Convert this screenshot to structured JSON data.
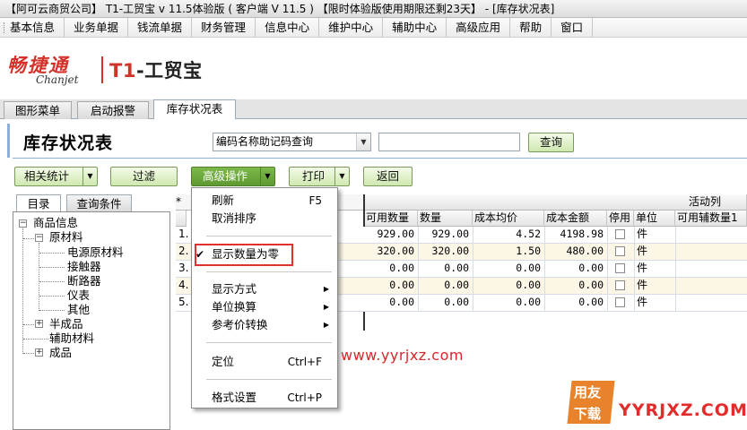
{
  "window": {
    "title": "【阿可云商贸公司】 T1-工贸宝 v 11.5体验版 ( 客户端 V 11.5 ) 【限时体验版使用期限还剩23天】 - [库存状况表]"
  },
  "menubar": [
    "基本信息",
    "业务单据",
    "钱流单据",
    "财务管理",
    "信息中心",
    "维护中心",
    "辅助中心",
    "高级应用",
    "帮助",
    "窗口"
  ],
  "brand": {
    "cn": "畅捷通",
    "en": "Chanjet",
    "product_prefix": "T1",
    "product_suffix": "-工贸宝"
  },
  "tabs": [
    "图形菜单",
    "启动报警",
    "库存状况表"
  ],
  "page": {
    "title": "库存状况表"
  },
  "search": {
    "mode_value": "编码名称助记码查询",
    "query_value": "",
    "button": "查询"
  },
  "toolbar": {
    "stats": "相关统计",
    "filter": "过滤",
    "advanced": "高级操作",
    "print": "打印",
    "back": "返回"
  },
  "left_tabs": [
    "目录",
    "查询条件"
  ],
  "tree": {
    "root": "商品信息",
    "raw": "原材料",
    "leaves": [
      "电源原材料",
      "接触器",
      "断路器",
      "仪表",
      "其他"
    ],
    "semi": "半成品",
    "aux": "辅助材料",
    "finished": "成品"
  },
  "grid": {
    "active_col_label": "活动列",
    "first_col_label": "*",
    "columns": [
      "可用数量",
      "数量",
      "成本均价",
      "成本金额",
      "停用",
      "单位",
      "可用辅数量1"
    ],
    "rows": [
      {
        "no": "1.",
        "avail": "929.00",
        "qty": "929.00",
        "avg": "4.52",
        "amount": "4198.98",
        "unit": "件"
      },
      {
        "no": "2.",
        "avail": "320.00",
        "qty": "320.00",
        "avg": "1.50",
        "amount": "480.00",
        "unit": "件"
      },
      {
        "no": "3.",
        "avail": "0.00",
        "qty": "0.00",
        "avg": "0.00",
        "amount": "0.00",
        "unit": "件"
      },
      {
        "no": "4.",
        "avail": "0.00",
        "qty": "0.00",
        "avg": "0.00",
        "amount": "0.00",
        "unit": "件"
      },
      {
        "no": "5.",
        "avail": "0.00",
        "qty": "0.00",
        "avg": "0.00",
        "amount": "0.00",
        "unit": "件"
      }
    ]
  },
  "dropdown": {
    "refresh": "刷新",
    "refresh_shortcut": "F5",
    "cancel_sort": "取消排序",
    "show_zero": "显示数量为零",
    "display_mode": "显示方式",
    "unit_convert": "单位换算",
    "ref_price": "参考价转换",
    "locate": "定位",
    "locate_shortcut": "Ctrl+F",
    "format": "格式设置",
    "format_shortcut": "Ctrl+P"
  },
  "watermarks": {
    "url": "www.yyrjxz.com",
    "badge_top": "用友",
    "badge_bottom": "下载",
    "site": "YYRJXZ.COM"
  },
  "colors": {
    "accent_green": "#cfe8b0",
    "pressed_green": "#5e9a31",
    "brand_red": "#d4312a",
    "highlight_red": "#e0322d"
  }
}
